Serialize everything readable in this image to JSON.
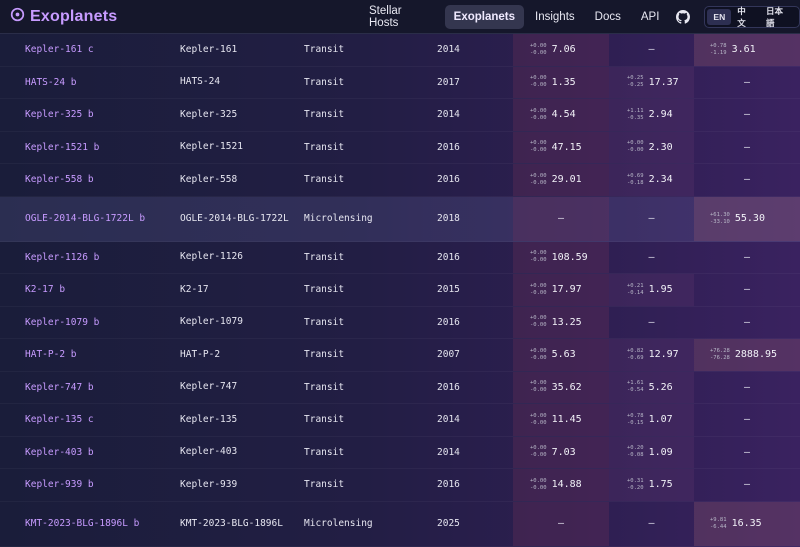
{
  "header": {
    "title": "Exoplanets",
    "nav": [
      "Stellar Hosts",
      "Exoplanets",
      "Insights",
      "Docs",
      "API"
    ],
    "active_nav": "Exoplanets",
    "languages": [
      "EN",
      "中文",
      "日本語"
    ],
    "active_language": "EN"
  },
  "rows": [
    {
      "name": "Kepler-161 c",
      "host": "Kepler-161",
      "method": "Transit",
      "year": "2014",
      "v1": {
        "val": "7.06",
        "up": "+0.00",
        "down": "-0.00"
      },
      "v2": {
        "val": "—"
      },
      "v3": {
        "val": "3.61",
        "up": "+0.78",
        "down": "-1.19"
      }
    },
    {
      "name": "HATS-24 b",
      "host": "HATS-24",
      "method": "Transit",
      "year": "2017",
      "v1": {
        "val": "1.35",
        "up": "+0.00",
        "down": "-0.00"
      },
      "v2": {
        "val": "17.37",
        "up": "+0.25",
        "down": "-0.25"
      },
      "v3": {
        "val": "—"
      }
    },
    {
      "name": "Kepler-325 b",
      "host": "Kepler-325",
      "method": "Transit",
      "year": "2014",
      "v1": {
        "val": "4.54",
        "up": "+0.00",
        "down": "-0.00"
      },
      "v2": {
        "val": "2.94",
        "up": "+1.11",
        "down": "-0.35"
      },
      "v3": {
        "val": "—"
      }
    },
    {
      "name": "Kepler-1521 b",
      "host": "Kepler-1521",
      "method": "Transit",
      "year": "2016",
      "v1": {
        "val": "47.15",
        "up": "+0.00",
        "down": "-0.00"
      },
      "v2": {
        "val": "2.30",
        "up": "+0.00",
        "down": "-0.00"
      },
      "v3": {
        "val": "—"
      }
    },
    {
      "name": "Kepler-558 b",
      "host": "Kepler-558",
      "method": "Transit",
      "year": "2016",
      "v1": {
        "val": "29.01",
        "up": "+0.00",
        "down": "-0.00"
      },
      "v2": {
        "val": "2.34",
        "up": "+0.69",
        "down": "-0.18"
      },
      "v3": {
        "val": "—"
      }
    },
    {
      "name": "OGLE-2014-BLG-1722L b",
      "host": "OGLE-2014-BLG-1722L",
      "method": "Microlensing",
      "year": "2018",
      "v1": {
        "val": "—"
      },
      "v2": {
        "val": "—"
      },
      "v3": {
        "val": "55.30",
        "up": "+61.30",
        "down": "-33.10"
      }
    },
    {
      "name": "Kepler-1126 b",
      "host": "Kepler-1126",
      "method": "Transit",
      "year": "2016",
      "v1": {
        "val": "108.59",
        "up": "+0.00",
        "down": "-0.00"
      },
      "v2": {
        "val": "—"
      },
      "v3": {
        "val": "—"
      }
    },
    {
      "name": "K2-17 b",
      "host": "K2-17",
      "method": "Transit",
      "year": "2015",
      "v1": {
        "val": "17.97",
        "up": "+0.00",
        "down": "-0.00"
      },
      "v2": {
        "val": "1.95",
        "up": "+0.21",
        "down": "-0.14"
      },
      "v3": {
        "val": "—"
      }
    },
    {
      "name": "Kepler-1079 b",
      "host": "Kepler-1079",
      "method": "Transit",
      "year": "2016",
      "v1": {
        "val": "13.25",
        "up": "+0.00",
        "down": "-0.00"
      },
      "v2": {
        "val": "—"
      },
      "v3": {
        "val": "—"
      }
    },
    {
      "name": "HAT-P-2 b",
      "host": "HAT-P-2",
      "method": "Transit",
      "year": "2007",
      "v1": {
        "val": "5.63",
        "up": "+0.00",
        "down": "-0.00"
      },
      "v2": {
        "val": "12.97",
        "up": "+0.82",
        "down": "-0.69"
      },
      "v3": {
        "val": "2888.95",
        "up": "+76.28",
        "down": "-76.28"
      }
    },
    {
      "name": "Kepler-747 b",
      "host": "Kepler-747",
      "method": "Transit",
      "year": "2016",
      "v1": {
        "val": "35.62",
        "up": "+0.00",
        "down": "-0.00"
      },
      "v2": {
        "val": "5.26",
        "up": "+1.61",
        "down": "-0.54"
      },
      "v3": {
        "val": "—"
      }
    },
    {
      "name": "Kepler-135 c",
      "host": "Kepler-135",
      "method": "Transit",
      "year": "2014",
      "v1": {
        "val": "11.45",
        "up": "+0.00",
        "down": "-0.00"
      },
      "v2": {
        "val": "1.07",
        "up": "+0.78",
        "down": "-0.15"
      },
      "v3": {
        "val": "—"
      }
    },
    {
      "name": "Kepler-403 b",
      "host": "Kepler-403",
      "method": "Transit",
      "year": "2014",
      "v1": {
        "val": "7.03",
        "up": "+0.00",
        "down": "-0.00"
      },
      "v2": {
        "val": "1.09",
        "up": "+0.20",
        "down": "-0.08"
      },
      "v3": {
        "val": "—"
      }
    },
    {
      "name": "Kepler-939 b",
      "host": "Kepler-939",
      "method": "Transit",
      "year": "2016",
      "v1": {
        "val": "14.88",
        "up": "+0.00",
        "down": "-0.00"
      },
      "v2": {
        "val": "1.75",
        "up": "+0.31",
        "down": "-0.20"
      },
      "v3": {
        "val": "—"
      }
    },
    {
      "name": "KMT-2023-BLG-1896L b",
      "host": "KMT-2023-BLG-1896L",
      "method": "Microlensing",
      "year": "2025",
      "v1": {
        "val": "—"
      },
      "v2": {
        "val": "—"
      },
      "v3": {
        "val": "16.35",
        "up": "+9.81",
        "down": "-6.44"
      }
    }
  ]
}
